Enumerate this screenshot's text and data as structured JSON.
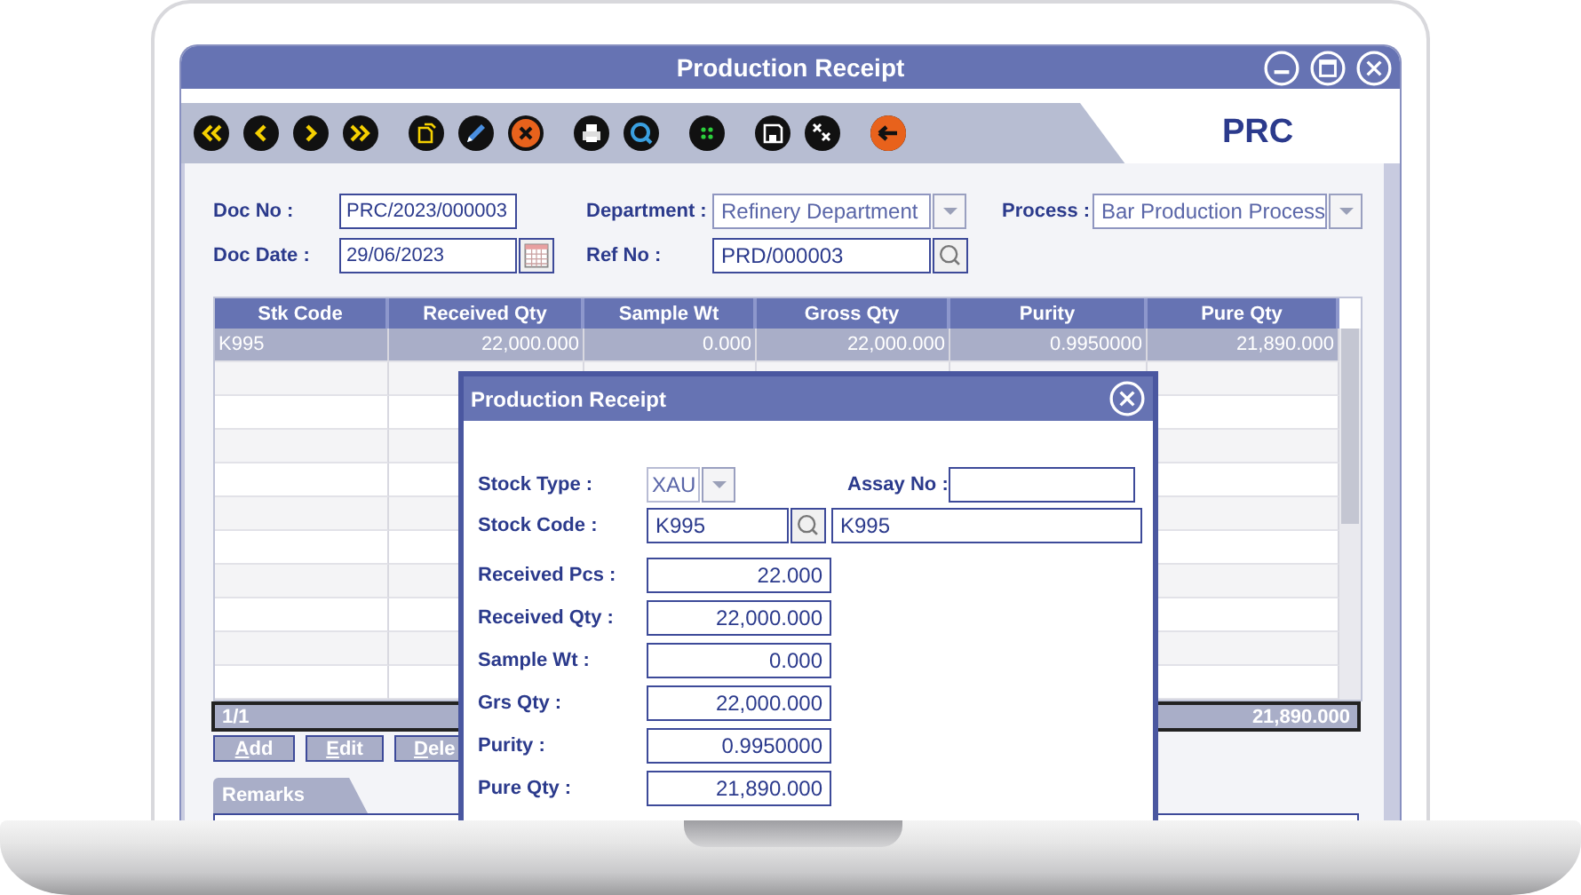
{
  "window": {
    "title": "Production Receipt",
    "controls": [
      {
        "kind": "minimize"
      },
      {
        "kind": "maximize"
      },
      {
        "kind": "close"
      }
    ]
  },
  "toolbar": [
    [
      {
        "kind": "first"
      },
      {
        "kind": "prev"
      },
      {
        "kind": "next"
      },
      {
        "kind": "last"
      }
    ],
    [
      {
        "kind": "new"
      },
      {
        "kind": "edit"
      },
      {
        "kind": "delete"
      }
    ],
    [
      {
        "kind": "print"
      },
      {
        "kind": "search"
      }
    ],
    [
      {
        "kind": "dots"
      }
    ],
    [
      {
        "kind": "save"
      },
      {
        "kind": "clear"
      }
    ],
    [
      {
        "kind": "exit"
      }
    ]
  ],
  "form_code": "PRC",
  "header_rows": [
    [
      {
        "label": "Doc No :",
        "value": "PRC/2023/000003",
        "kind": "text"
      },
      {
        "label": "Department :",
        "value": "Refinery Department",
        "kind": "dropdown"
      },
      {
        "label": "Process :",
        "value": "Bar Production Process",
        "kind": "dropdown"
      }
    ],
    [
      {
        "label": "Doc Date :",
        "value": "29/06/2023",
        "kind": "date"
      },
      {
        "label": "Ref No :",
        "value": "PRD/000003",
        "kind": "lookup"
      }
    ]
  ],
  "table": {
    "columns": [
      "Stk Code",
      "Received Qty",
      "Sample Wt",
      "Gross Qty",
      "Purity",
      "Pure Qty"
    ],
    "rows": [
      {
        "cells": [
          "K995",
          "22,000.000",
          "0.000",
          "22,000.000",
          "0.9950000",
          "21,890.000"
        ],
        "selected": true
      }
    ],
    "footer": {
      "count": "1/1",
      "total": "21,890.000"
    }
  },
  "buttons": [
    "Add",
    "Edit",
    "Dele"
  ],
  "remarks_tab": {
    "label": "Remarks"
  },
  "dialog": {
    "title": "Production Receipt",
    "fields": [
      {
        "kind": "dropdown",
        "label": "Stock Type :",
        "value": "XAU",
        "side_label": "Assay No :"
      },
      {
        "kind": "lookup",
        "label": "Stock Code :",
        "value": "K995",
        "name": "K995"
      },
      {
        "kind": "number",
        "label": "Received Pcs :",
        "value": "22.000"
      },
      {
        "kind": "number",
        "label": "Received Qty :",
        "value": "22,000.000"
      },
      {
        "kind": "number",
        "label": "Sample Wt :",
        "value": "0.000"
      },
      {
        "kind": "number",
        "label": "Grs Qty :",
        "value": "22,000.000"
      },
      {
        "kind": "number",
        "label": "Purity :",
        "value": "0.9950000"
      },
      {
        "kind": "number",
        "label": "Pure Qty :",
        "value": "21,890.000"
      }
    ]
  }
}
